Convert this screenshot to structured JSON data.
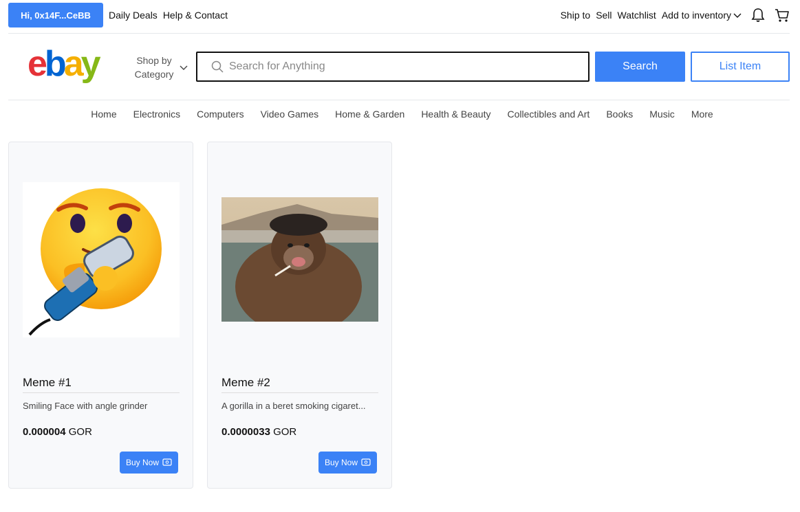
{
  "topbar": {
    "greeting": "Hi, 0x14F...CeBB",
    "links": [
      "Daily Deals",
      "Help & Contact"
    ],
    "right_links": [
      "Ship to",
      "Sell",
      "Watchlist"
    ],
    "inventory_label": "Add to inventory",
    "icons": [
      "chevron-down-icon",
      "bell-icon",
      "cart-icon"
    ]
  },
  "header": {
    "logo_letters": [
      "e",
      "b",
      "a",
      "y"
    ],
    "logo_colors": [
      "#e53238",
      "#0064d2",
      "#f5af02",
      "#86b817"
    ],
    "shop_by": "Shop by Category",
    "search_placeholder": "Search for Anything",
    "search_button": "Search",
    "list_button": "List Item"
  },
  "nav": [
    "Home",
    "Electronics",
    "Computers",
    "Video Games",
    "Home & Garden",
    "Health & Beauty",
    "Collectibles and Art",
    "Books",
    "Music",
    "More"
  ],
  "products": [
    {
      "title": "Meme #1",
      "description": "Smiling Face with angle grinder",
      "price": "0.000004",
      "currency": "GOR",
      "buy_label": "Buy Now",
      "image": "smiling-face-angle-grinder-image"
    },
    {
      "title": "Meme #2",
      "description": "A gorilla in a beret smoking cigaret...",
      "price": "0.0000033",
      "currency": "GOR",
      "buy_label": "Buy Now",
      "image": "gorilla-beret-cigarette-image"
    }
  ],
  "colors": {
    "accent": "#3b82f6"
  }
}
